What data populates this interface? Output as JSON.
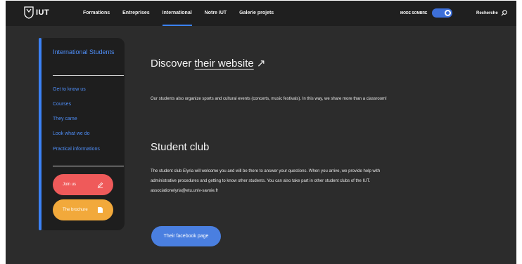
{
  "header": {
    "logo_text": "IUT",
    "nav": [
      "Formations",
      "Entreprises",
      "International",
      "Notre IUT",
      "Galerie projets"
    ],
    "active_nav_index": 2,
    "mode_label": "MODE SOMBRE",
    "dark_mode_on": true,
    "search_label": "Recherche"
  },
  "sidebar": {
    "title": "International Students",
    "items": [
      "Get to know us",
      "Courses",
      "They came",
      "Look what we do",
      "Practical informations"
    ],
    "join_label": "Join us",
    "brochure_label": "The brochure"
  },
  "main": {
    "discover_prefix": "Discover ",
    "discover_link": "their website",
    "events_text": "Our students also organize sports and cultural events (concerts, music festivals). In this way, we share more than a classroom!",
    "club_title": "Student club",
    "club_line1": "The student club Elyria will welcome you and will be there to answer your questions. When you arrive, we provide help with",
    "club_line2": "administrative procedures and getting to know other students. You can also take part in other student clubs of the IUT.",
    "club_email": "associationelyria@etu.univ-savoie.fr",
    "facebook_label": "Their facebook page"
  },
  "colors": {
    "background": "#2c2c2c",
    "accent": "#3b82f6",
    "join": "#ef5a5a",
    "brochure": "#f2a93b"
  }
}
